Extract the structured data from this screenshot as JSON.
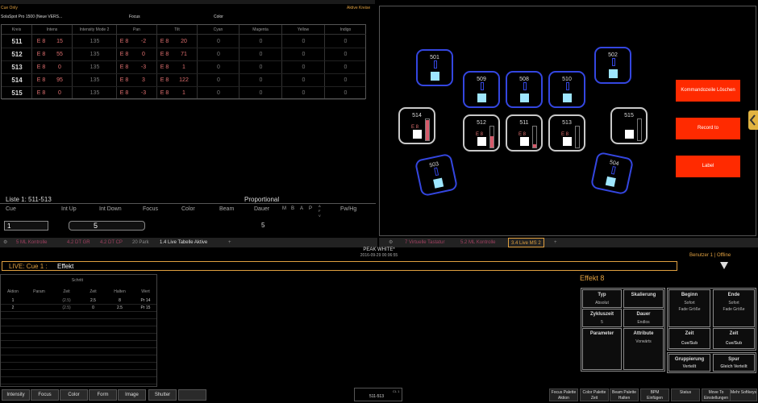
{
  "sheet": {
    "title": "Cue Only",
    "fixture": "SolaSpot Pro 1500 (Neue VERS...",
    "aktive": "Aktive Kreise"
  },
  "groups": {
    "focus": "Focus",
    "color": "Color"
  },
  "table": {
    "headers": [
      "Kreis",
      "Intens",
      "Intensity Mode 2",
      "Pan",
      "Tilt",
      "Cyan",
      "Magenta",
      "Yellow",
      "Indigo"
    ],
    "rows": [
      {
        "ch": "511",
        "i_e": "E 8",
        "i": "15",
        "mode": "135",
        "pan_e": "E 8",
        "pan": "-2",
        "tilt_e": "E 8",
        "tilt": "20",
        "c": "0",
        "m": "0",
        "y": "0",
        "ind": "0"
      },
      {
        "ch": "512",
        "i_e": "E 8",
        "i": "55",
        "mode": "135",
        "pan_e": "E 8",
        "pan": "0",
        "tilt_e": "E 8",
        "tilt": "71",
        "c": "0",
        "m": "0",
        "y": "0",
        "ind": "0"
      },
      {
        "ch": "513",
        "i_e": "E 8",
        "i": "0",
        "mode": "135",
        "pan_e": "E 8",
        "pan": "-3",
        "tilt_e": "E 8",
        "tilt": "1",
        "c": "0",
        "m": "0",
        "y": "0",
        "ind": "0"
      },
      {
        "ch": "514",
        "i_e": "E 8",
        "i": "95",
        "mode": "135",
        "pan_e": "E 8",
        "pan": "3",
        "tilt_e": "E 8",
        "tilt": "122",
        "c": "0",
        "m": "0",
        "y": "0",
        "ind": "0"
      },
      {
        "ch": "515",
        "i_e": "E 8",
        "i": "0",
        "mode": "135",
        "pan_e": "E 8",
        "pan": "-3",
        "tilt_e": "E 8",
        "tilt": "1",
        "c": "0",
        "m": "0",
        "y": "0",
        "ind": "0"
      }
    ]
  },
  "magic": {
    "fixtures": [
      {
        "num": "501",
        "style": "blue",
        "sq": "blue",
        "level": 0
      },
      {
        "num": "509",
        "style": "blue",
        "sq": "blue",
        "level": 0
      },
      {
        "num": "508",
        "style": "blue",
        "sq": "blue",
        "level": 0
      },
      {
        "num": "510",
        "style": "blue",
        "sq": "blue",
        "level": 0
      },
      {
        "num": "502",
        "style": "blue",
        "sq": "blue",
        "level": 0
      },
      {
        "num": "514",
        "style": "grey",
        "sq": "white",
        "level": 0.95,
        "label": "E 8"
      },
      {
        "num": "512",
        "style": "grey",
        "sq": "white",
        "level": 0.55,
        "label": "E 8"
      },
      {
        "num": "511",
        "style": "grey",
        "sq": "white",
        "level": 0.15,
        "label": "E 8"
      },
      {
        "num": "513",
        "style": "grey",
        "sq": "white",
        "level": 0,
        "label": "E 8"
      },
      {
        "num": "515",
        "style": "grey",
        "sq": "white",
        "level": 0
      },
      {
        "num": "503",
        "style": "blue",
        "sq": "blue",
        "level": 0
      },
      {
        "num": "504",
        "style": "blue",
        "sq": "blue",
        "level": 0
      }
    ],
    "buttons": [
      "Kommandozeile Löschen",
      "Record to",
      "Label"
    ]
  },
  "cuelist": {
    "title": "Liste 1: 511-513",
    "mode": "Proportional",
    "headers": [
      "Cue",
      "Int Up",
      "Int Down",
      "Focus",
      "Color",
      "Beam",
      "Dauer",
      "M",
      "B",
      "A",
      "P",
      "A",
      "F",
      "V",
      "Fw/Hg"
    ],
    "cue_value": "1",
    "intup_value": "5",
    "dauer_value": "5"
  },
  "tabs_left": [
    "5 ML Kontrolle",
    "4.2 DT GR",
    "4.2 DT CP",
    "20 Park",
    "1.4 Live Tabelle Aktive"
  ],
  "tabs_right": [
    "7 Virtuelle Tastatur",
    "5.2 ML Kontrolle",
    "3.4 Live MS 2"
  ],
  "tab_plus": "+",
  "live": {
    "peak": "PEAK WHITE*",
    "date": "2016-09-29 00:06:55",
    "user": "Benutzer 1",
    "offline": "Offline",
    "label": "LIVE: Cue  1 :",
    "target": "Effekt"
  },
  "efftable": {
    "group": "Schritt",
    "headers": [
      "Aktion",
      "Param",
      "Zeit",
      "Zeit",
      "Halten",
      "Wert"
    ],
    "rows": [
      {
        "a": "1",
        "p": "",
        "z1": "(2.5)",
        "z2": "2.5",
        "h": "8",
        "w": "Pr 14"
      },
      {
        "a": "2",
        "p": "",
        "z1": "(2.5)",
        "z2": "0",
        "h": "2.5",
        "w": "Pr 15"
      }
    ]
  },
  "effect": {
    "title": "Effekt  8",
    "boxes": {
      "typ": {
        "t": "Typ",
        "s": "Absolut"
      },
      "skal": {
        "t": "Skalierung",
        "s": ""
      },
      "zyklus": {
        "t": "Zykluszeit",
        "s": "5"
      },
      "dauer": {
        "t": "Dauer",
        "s": "Endlos"
      },
      "param": {
        "t": "Parameter",
        "s": ""
      },
      "attr": {
        "t": "Attribute",
        "s": "Vorwärts"
      },
      "beginn": {
        "t": "Beginn",
        "s1": "Sofort",
        "s2": "Fade Größe"
      },
      "ende": {
        "t": "Ende",
        "s1": "Sofort",
        "s2": "Fade Größe"
      },
      "zeit1": {
        "t": "Zeit",
        "s": "Cue/Sub"
      },
      "zeit2": {
        "t": "Zeit",
        "s": "Cue/Sub"
      },
      "grupp": {
        "t": "Gruppierung",
        "s": "Verteilt"
      },
      "spur": {
        "t": "Spur",
        "s": "Gleich Verteilt"
      }
    }
  },
  "bottom": {
    "buttons": [
      "Intensity",
      "Focus",
      "Color",
      "Form",
      "Image",
      "Shutter",
      ""
    ],
    "cmd": "511-513",
    "cmd_small": "CL 1",
    "right": [
      {
        "a": "Focus Palette",
        "b": "Aktion"
      },
      {
        "a": "Color Palette",
        "b": "Zeit"
      },
      {
        "a": "Beam Palette",
        "b": "Halten"
      },
      {
        "a": "BPM",
        "b": "Einfügen"
      },
      {
        "a": "",
        "b": "Status"
      },
      {
        "a": "Move To",
        "b": "Einstellungen"
      },
      {
        "a": "",
        "b": "Mehr Softkeys"
      }
    ]
  }
}
